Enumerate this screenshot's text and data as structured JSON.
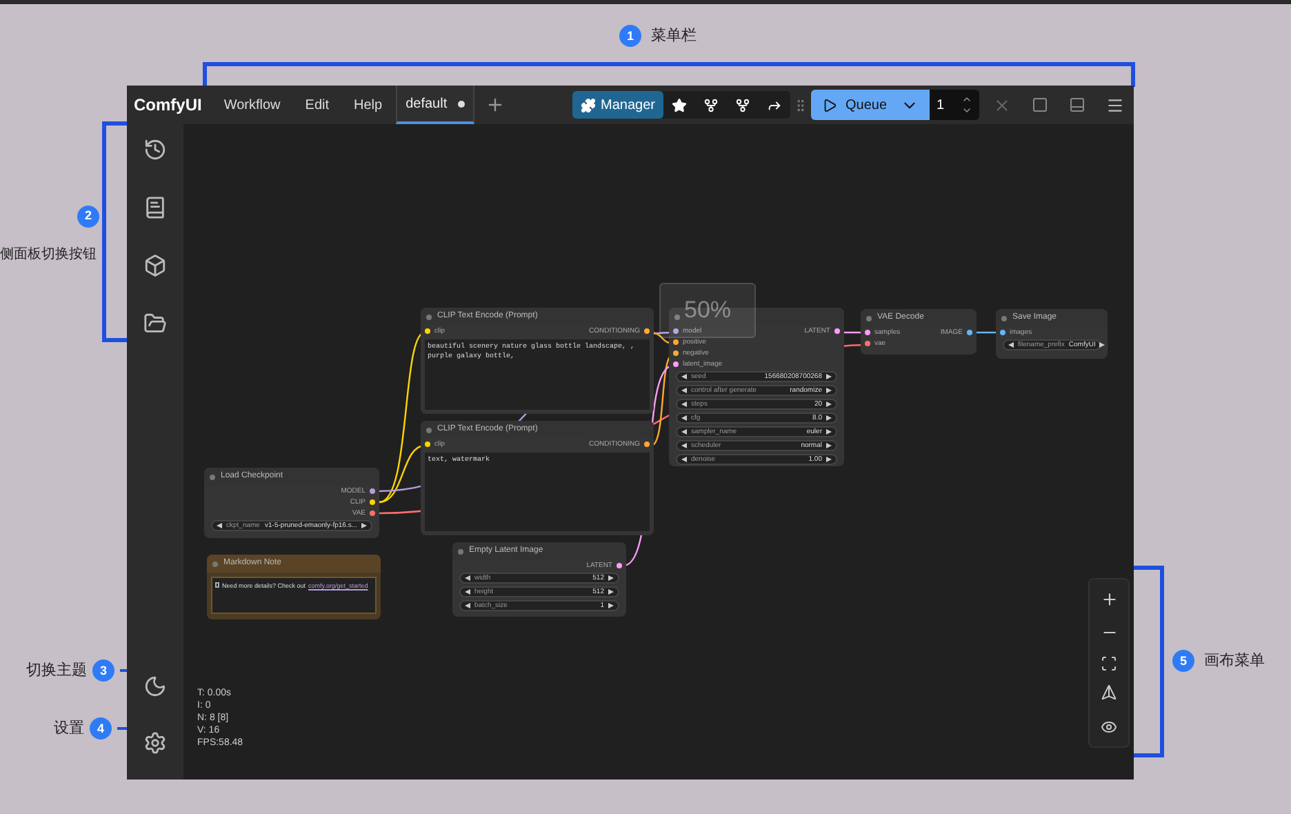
{
  "annotations": [
    {
      "number": "1",
      "label": "菜单栏"
    },
    {
      "number": "2",
      "label": "侧面板切换按钮"
    },
    {
      "number": "3",
      "label": "切换主题"
    },
    {
      "number": "4",
      "label": "设置"
    },
    {
      "number": "5",
      "label": "画布菜单"
    }
  ],
  "menubar": {
    "logo": "ComfyUI",
    "menus": [
      "Workflow",
      "Edit",
      "Help"
    ],
    "tab": {
      "label": "default",
      "modified": true,
      "selected": true
    },
    "manager": "Manager",
    "queue": "Queue",
    "batch_count": "1"
  },
  "canvas": {
    "zoom": "50%",
    "nodes": [
      {
        "title": "CLIP Text Encode (Prompt)",
        "inputs": [
          {
            "name": "clip",
            "color": "#ffd500"
          }
        ],
        "outputs": [
          {
            "name": "CONDITIONING",
            "color": "#ffa931"
          }
        ],
        "text": "beautiful scenery nature glass bottle landscape, , purple galaxy bottle,"
      },
      {
        "title": "CLIP Text Encode (Prompt)",
        "inputs": [
          {
            "name": "clip",
            "color": "#ffd500"
          }
        ],
        "outputs": [
          {
            "name": "CONDITIONING",
            "color": "#ffa931"
          }
        ],
        "text": "text, watermark"
      },
      {
        "title": "Load Checkpoint",
        "outputs": [
          {
            "name": "MODEL",
            "color": "#b39ddb"
          },
          {
            "name": "CLIP",
            "color": "#ffd500"
          },
          {
            "name": "VAE",
            "color": "#ff6e6e"
          }
        ],
        "widgets": [
          {
            "name": "ckpt_name",
            "value": "v1-5-pruned-emaonly-fp16.s..."
          }
        ]
      },
      {
        "title": "Markdown Note",
        "kind": "note",
        "note": "Need more details? Check out",
        "link": "comfy.org/get_started"
      },
      {
        "title": "Empty Latent Image",
        "outputs": [
          {
            "name": "LATENT",
            "color": "#ff9cf9"
          }
        ],
        "widgets": [
          {
            "name": "width",
            "value": "512"
          },
          {
            "name": "height",
            "value": "512"
          },
          {
            "name": "batch_size",
            "value": "1"
          }
        ]
      },
      {
        "inputs": [
          {
            "name": "model",
            "color": "#b39ddb"
          },
          {
            "name": "positive",
            "color": "#ffa931"
          },
          {
            "name": "negative",
            "color": "#ffa931"
          },
          {
            "name": "latent_image",
            "color": "#ff9cf9"
          }
        ],
        "outputs": [
          {
            "name": "LATENT",
            "color": "#ff9cf9"
          }
        ],
        "widgets": [
          {
            "name": "seed",
            "value": "156680208700268"
          },
          {
            "name": "control after generate",
            "value": "randomize"
          },
          {
            "name": "steps",
            "value": "20"
          },
          {
            "name": "cfg",
            "value": "8.0"
          },
          {
            "name": "sampler_name",
            "value": "euler"
          },
          {
            "name": "scheduler",
            "value": "normal"
          },
          {
            "name": "denoise",
            "value": "1.00"
          }
        ]
      },
      {
        "title": "VAE Decode",
        "inputs": [
          {
            "name": "samples",
            "color": "#ff9cf9"
          },
          {
            "name": "vae",
            "color": "#ff6e6e"
          }
        ],
        "outputs": [
          {
            "name": "IMAGE",
            "color": "#64b5f6"
          }
        ]
      },
      {
        "title": "Save Image",
        "inputs": [
          {
            "name": "images",
            "color": "#64b5f6"
          }
        ],
        "widgets": [
          {
            "name": "filename_prefix",
            "value": "ComfyUI"
          }
        ]
      }
    ],
    "stats": [
      "T: 0.00s",
      "I: 0",
      "N: 8 [8]",
      "V: 16",
      "FPS:58.48"
    ]
  }
}
